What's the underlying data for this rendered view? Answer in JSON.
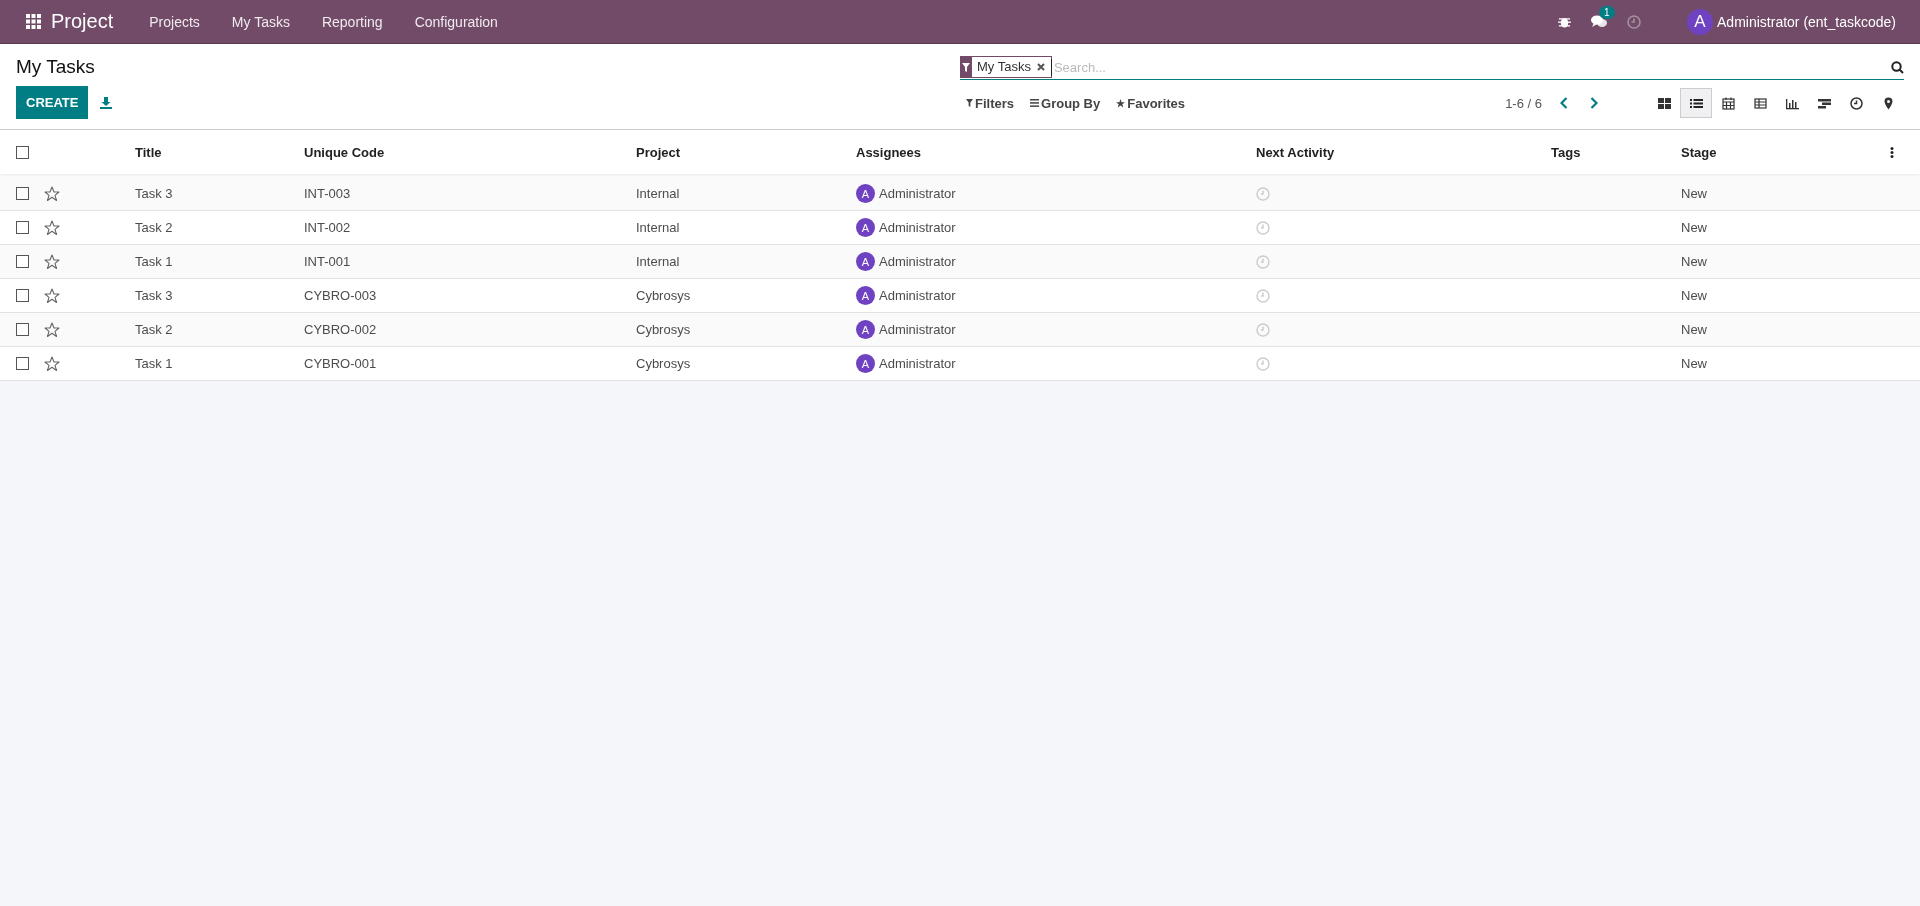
{
  "navbar": {
    "app_name": "Project",
    "menu": [
      "Projects",
      "My Tasks",
      "Reporting",
      "Configuration"
    ],
    "message_count": "1",
    "user_initial": "A",
    "user_name": "Administrator (ent_taskcode)"
  },
  "control_panel": {
    "title": "My Tasks",
    "create_button": "CREATE",
    "search": {
      "facet": "My Tasks",
      "placeholder": "Search..."
    },
    "filters": "Filters",
    "group_by": "Group By",
    "favorites": "Favorites",
    "pager": "1-6 / 6",
    "views": [
      {
        "kind": "kanban",
        "selected": false
      },
      {
        "kind": "list",
        "selected": true
      },
      {
        "kind": "calendar",
        "selected": false
      },
      {
        "kind": "pivot",
        "selected": false
      },
      {
        "kind": "graph",
        "selected": false
      },
      {
        "kind": "gantt",
        "selected": false
      },
      {
        "kind": "activity",
        "selected": false
      },
      {
        "kind": "map",
        "selected": false
      }
    ]
  },
  "table": {
    "columns": [
      "Title",
      "Unique Code",
      "Project",
      "Assignees",
      "Next Activity",
      "Tags",
      "Stage"
    ],
    "select_all_checked": false,
    "rows": [
      {
        "checked": false,
        "starred": false,
        "title": "Task 3",
        "code": "INT-003",
        "project": "Internal",
        "assignee_initial": "A",
        "assignee": "Administrator",
        "stage": "New"
      },
      {
        "checked": false,
        "starred": false,
        "title": "Task 2",
        "code": "INT-002",
        "project": "Internal",
        "assignee_initial": "A",
        "assignee": "Administrator",
        "stage": "New"
      },
      {
        "checked": false,
        "starred": false,
        "title": "Task 1",
        "code": "INT-001",
        "project": "Internal",
        "assignee_initial": "A",
        "assignee": "Administrator",
        "stage": "New"
      },
      {
        "checked": false,
        "starred": false,
        "title": "Task 3",
        "code": "CYBRO-003",
        "project": "Cybrosys",
        "assignee_initial": "A",
        "assignee": "Administrator",
        "stage": "New"
      },
      {
        "checked": false,
        "starred": false,
        "title": "Task 2",
        "code": "CYBRO-002",
        "project": "Cybrosys",
        "assignee_initial": "A",
        "assignee": "Administrator",
        "stage": "New"
      },
      {
        "checked": false,
        "starred": false,
        "title": "Task 1",
        "code": "CYBRO-001",
        "project": "Cybrosys",
        "assignee_initial": "A",
        "assignee": "Administrator",
        "stage": "New"
      }
    ]
  }
}
